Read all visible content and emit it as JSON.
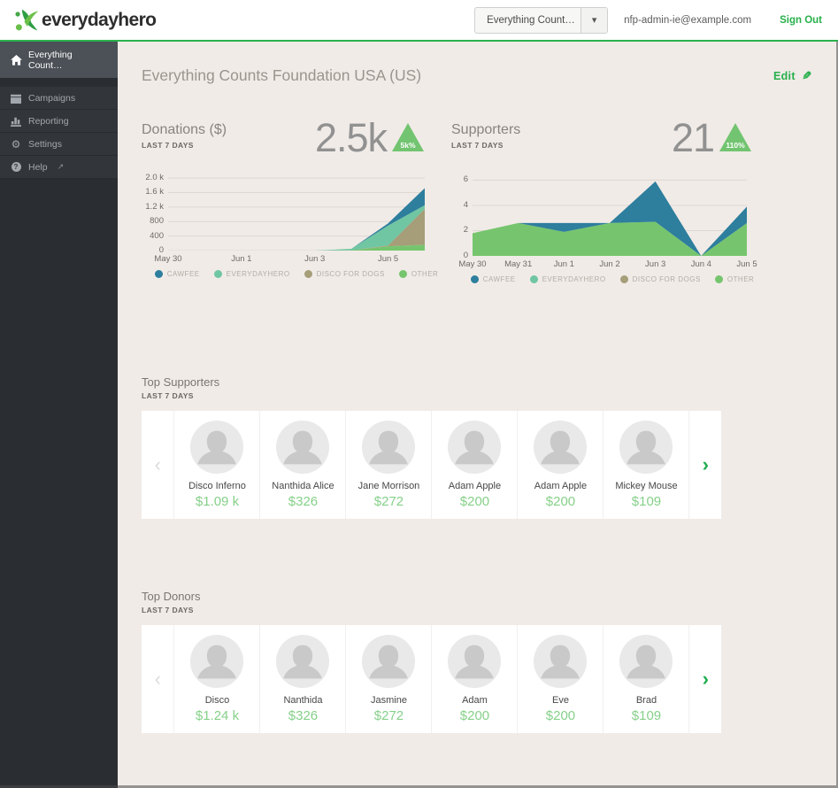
{
  "app": {
    "accent_green": "#27b04b",
    "page_bg": "#f0ebe7",
    "sidebar_bg": "#2a2d31",
    "sidebar_active_bg": "#4b5157"
  },
  "glyphs": {
    "chevron_down": "▾",
    "chevron_left": "‹",
    "chevron_right": "›",
    "pencil": "✎",
    "gear": "⚙",
    "help": "?",
    "external_link": "↗"
  },
  "header": {
    "logo_text": "everydayhero",
    "org_dropdown_value": "Everything Count…",
    "email": "nfp-admin-ie@example.com",
    "sign_out_label": "Sign Out"
  },
  "sidebar": {
    "items": [
      {
        "label": "Everything Count…",
        "icon": "home",
        "active": true
      },
      {
        "label": "Campaigns",
        "icon": "calendar",
        "active": false
      },
      {
        "label": "Reporting",
        "icon": "bar-chart",
        "active": false
      },
      {
        "label": "Settings",
        "icon": "gear",
        "active": false
      },
      {
        "label": "Help",
        "icon": "help-circle",
        "external": true,
        "active": false
      }
    ]
  },
  "page": {
    "title": "Everything Counts Foundation USA (US)",
    "edit_label": "Edit"
  },
  "chart_data": [
    {
      "type": "area",
      "stacked": true,
      "title": "Donations ($)",
      "subtitle": "LAST 7 DAYS",
      "kpi": "2.5k",
      "kpi_change": "5k%",
      "badge_color": "#72c470",
      "grid": true,
      "grid_color": "#ded8d2",
      "legend_position": "bottom",
      "x": [
        "May 30",
        "May 31",
        "Jun 1",
        "Jun 2",
        "Jun 3",
        "Jun 4",
        "Jun 5",
        "Jun 6"
      ],
      "xticks": [
        {
          "index": 0,
          "label": "May 30"
        },
        {
          "index": 2,
          "label": "Jun 1"
        },
        {
          "index": 4,
          "label": "Jun 3"
        },
        {
          "index": 6,
          "label": "Jun 5"
        }
      ],
      "yticks": [
        {
          "value": 0,
          "label": "0"
        },
        {
          "value": 400,
          "label": "400"
        },
        {
          "value": 800,
          "label": "800"
        },
        {
          "value": 1200,
          "label": "1.2 k"
        },
        {
          "value": 1600,
          "label": "1.6 k"
        },
        {
          "value": 2000,
          "label": "2.0 k"
        }
      ],
      "ylim": [
        0,
        2100
      ],
      "stack_order": "reverse-of-series-list (OTHER bottom, CAWFEE top)",
      "series": [
        {
          "name": "CAWFEE",
          "color": "#2e7e9d",
          "values": [
            0,
            0,
            0,
            0,
            0,
            0,
            60,
            470
          ]
        },
        {
          "name": "EVERYDAYHERO",
          "color": "#70c6a2",
          "values": [
            0,
            0,
            0,
            0,
            0,
            40,
            550,
            100
          ]
        },
        {
          "name": "DISCO FOR DOGS",
          "color": "#a59e79",
          "values": [
            0,
            0,
            0,
            0,
            0,
            0,
            20,
            990
          ]
        },
        {
          "name": "OTHER",
          "color": "#76c56e",
          "values": [
            0,
            0,
            0,
            0,
            0,
            10,
            120,
            160
          ]
        }
      ]
    },
    {
      "type": "area",
      "stacked": true,
      "title": "Supporters",
      "subtitle": "LAST 7 DAYS",
      "kpi": "21",
      "kpi_change": "110%",
      "badge_color": "#72c470",
      "grid": true,
      "grid_color": "#ded8d2",
      "legend_position": "bottom",
      "x": [
        "May 30",
        "May 31",
        "Jun 1",
        "Jun 2",
        "Jun 3",
        "Jun 4",
        "Jun 5"
      ],
      "xticks": [
        {
          "index": 0,
          "label": "May 30"
        },
        {
          "index": 1,
          "label": "May 31"
        },
        {
          "index": 2,
          "label": "Jun 1"
        },
        {
          "index": 3,
          "label": "Jun 2"
        },
        {
          "index": 4,
          "label": "Jun 3"
        },
        {
          "index": 5,
          "label": "Jun 4"
        },
        {
          "index": 6,
          "label": "Jun 5"
        }
      ],
      "yticks": [
        {
          "value": 0,
          "label": "0"
        },
        {
          "value": 2,
          "label": "2"
        },
        {
          "value": 4,
          "label": "4"
        },
        {
          "value": 6,
          "label": "6"
        }
      ],
      "ylim": [
        0,
        6.45
      ],
      "stack_order": "reverse-of-series-list (OTHER bottom, CAWFEE top)",
      "series": [
        {
          "name": "CAWFEE",
          "color": "#2e7e9d",
          "values": [
            0,
            0,
            0.7,
            0,
            3.2,
            0,
            1.3
          ]
        },
        {
          "name": "EVERYDAYHERO",
          "color": "#70c6a2",
          "values": [
            0,
            0,
            0,
            0,
            0,
            0,
            0
          ]
        },
        {
          "name": "DISCO FOR DOGS",
          "color": "#a59e79",
          "values": [
            0,
            0,
            0,
            0,
            0,
            0,
            0
          ]
        },
        {
          "name": "OTHER",
          "color": "#76c56e",
          "values": [
            1.8,
            2.6,
            1.9,
            2.6,
            2.7,
            0,
            2.6
          ]
        }
      ]
    }
  ],
  "sections": {
    "top_supporters": {
      "title": "Top Supporters",
      "subtitle": "LAST 7 DAYS",
      "people": [
        {
          "name": "Disco Inferno",
          "amount": "$1.09 k"
        },
        {
          "name": "Nanthida Alice",
          "amount": "$326"
        },
        {
          "name": "Jane Morrison",
          "amount": "$272"
        },
        {
          "name": "Adam Apple",
          "amount": "$200"
        },
        {
          "name": "Adam Apple",
          "amount": "$200"
        },
        {
          "name": "Mickey Mouse",
          "amount": "$109"
        }
      ]
    },
    "top_donors": {
      "title": "Top Donors",
      "subtitle": "LAST 7 DAYS",
      "people": [
        {
          "name": "Disco",
          "amount": "$1.24 k"
        },
        {
          "name": "Nanthida",
          "amount": "$326"
        },
        {
          "name": "Jasmine",
          "amount": "$272"
        },
        {
          "name": "Adam",
          "amount": "$200"
        },
        {
          "name": "Eve",
          "amount": "$200"
        },
        {
          "name": "Brad",
          "amount": "$109"
        }
      ]
    }
  }
}
